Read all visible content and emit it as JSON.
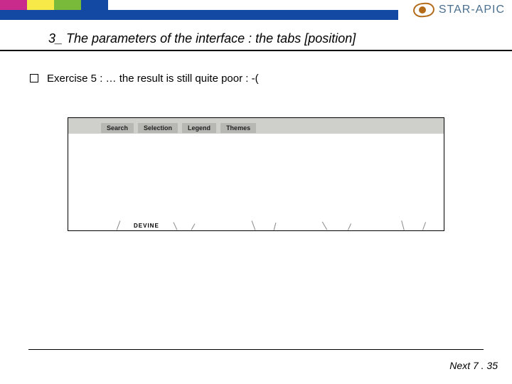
{
  "brand": {
    "name": "STAR-APIC"
  },
  "title": "3_ The parameters of the interface : the tabs [position]",
  "bullet": {
    "text": "Exercise 5 : … the result is still quite poor : -("
  },
  "screenshot": {
    "tabs": [
      "Search",
      "Selection",
      "Legend",
      "Themes"
    ],
    "fragment_label": "DEVINE"
  },
  "footer": {
    "text": "Next 7 . 35"
  }
}
